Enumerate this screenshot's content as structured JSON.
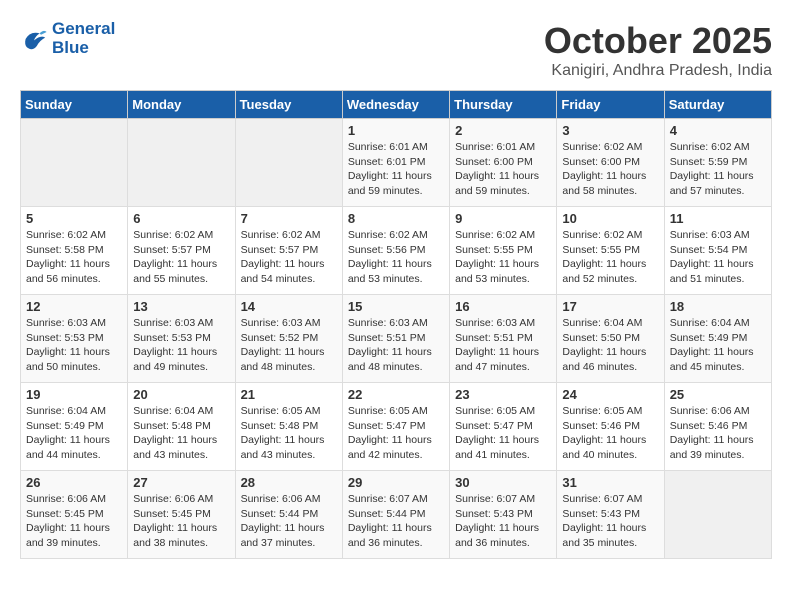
{
  "logo": {
    "line1": "General",
    "line2": "Blue"
  },
  "title": "October 2025",
  "subtitle": "Kanigiri, Andhra Pradesh, India",
  "weekdays": [
    "Sunday",
    "Monday",
    "Tuesday",
    "Wednesday",
    "Thursday",
    "Friday",
    "Saturday"
  ],
  "weeks": [
    [
      {
        "day": "",
        "info": ""
      },
      {
        "day": "",
        "info": ""
      },
      {
        "day": "",
        "info": ""
      },
      {
        "day": "1",
        "info": "Sunrise: 6:01 AM\nSunset: 6:01 PM\nDaylight: 11 hours\nand 59 minutes."
      },
      {
        "day": "2",
        "info": "Sunrise: 6:01 AM\nSunset: 6:00 PM\nDaylight: 11 hours\nand 59 minutes."
      },
      {
        "day": "3",
        "info": "Sunrise: 6:02 AM\nSunset: 6:00 PM\nDaylight: 11 hours\nand 58 minutes."
      },
      {
        "day": "4",
        "info": "Sunrise: 6:02 AM\nSunset: 5:59 PM\nDaylight: 11 hours\nand 57 minutes."
      }
    ],
    [
      {
        "day": "5",
        "info": "Sunrise: 6:02 AM\nSunset: 5:58 PM\nDaylight: 11 hours\nand 56 minutes."
      },
      {
        "day": "6",
        "info": "Sunrise: 6:02 AM\nSunset: 5:57 PM\nDaylight: 11 hours\nand 55 minutes."
      },
      {
        "day": "7",
        "info": "Sunrise: 6:02 AM\nSunset: 5:57 PM\nDaylight: 11 hours\nand 54 minutes."
      },
      {
        "day": "8",
        "info": "Sunrise: 6:02 AM\nSunset: 5:56 PM\nDaylight: 11 hours\nand 53 minutes."
      },
      {
        "day": "9",
        "info": "Sunrise: 6:02 AM\nSunset: 5:55 PM\nDaylight: 11 hours\nand 53 minutes."
      },
      {
        "day": "10",
        "info": "Sunrise: 6:02 AM\nSunset: 5:55 PM\nDaylight: 11 hours\nand 52 minutes."
      },
      {
        "day": "11",
        "info": "Sunrise: 6:03 AM\nSunset: 5:54 PM\nDaylight: 11 hours\nand 51 minutes."
      }
    ],
    [
      {
        "day": "12",
        "info": "Sunrise: 6:03 AM\nSunset: 5:53 PM\nDaylight: 11 hours\nand 50 minutes."
      },
      {
        "day": "13",
        "info": "Sunrise: 6:03 AM\nSunset: 5:53 PM\nDaylight: 11 hours\nand 49 minutes."
      },
      {
        "day": "14",
        "info": "Sunrise: 6:03 AM\nSunset: 5:52 PM\nDaylight: 11 hours\nand 48 minutes."
      },
      {
        "day": "15",
        "info": "Sunrise: 6:03 AM\nSunset: 5:51 PM\nDaylight: 11 hours\nand 48 minutes."
      },
      {
        "day": "16",
        "info": "Sunrise: 6:03 AM\nSunset: 5:51 PM\nDaylight: 11 hours\nand 47 minutes."
      },
      {
        "day": "17",
        "info": "Sunrise: 6:04 AM\nSunset: 5:50 PM\nDaylight: 11 hours\nand 46 minutes."
      },
      {
        "day": "18",
        "info": "Sunrise: 6:04 AM\nSunset: 5:49 PM\nDaylight: 11 hours\nand 45 minutes."
      }
    ],
    [
      {
        "day": "19",
        "info": "Sunrise: 6:04 AM\nSunset: 5:49 PM\nDaylight: 11 hours\nand 44 minutes."
      },
      {
        "day": "20",
        "info": "Sunrise: 6:04 AM\nSunset: 5:48 PM\nDaylight: 11 hours\nand 43 minutes."
      },
      {
        "day": "21",
        "info": "Sunrise: 6:05 AM\nSunset: 5:48 PM\nDaylight: 11 hours\nand 43 minutes."
      },
      {
        "day": "22",
        "info": "Sunrise: 6:05 AM\nSunset: 5:47 PM\nDaylight: 11 hours\nand 42 minutes."
      },
      {
        "day": "23",
        "info": "Sunrise: 6:05 AM\nSunset: 5:47 PM\nDaylight: 11 hours\nand 41 minutes."
      },
      {
        "day": "24",
        "info": "Sunrise: 6:05 AM\nSunset: 5:46 PM\nDaylight: 11 hours\nand 40 minutes."
      },
      {
        "day": "25",
        "info": "Sunrise: 6:06 AM\nSunset: 5:46 PM\nDaylight: 11 hours\nand 39 minutes."
      }
    ],
    [
      {
        "day": "26",
        "info": "Sunrise: 6:06 AM\nSunset: 5:45 PM\nDaylight: 11 hours\nand 39 minutes."
      },
      {
        "day": "27",
        "info": "Sunrise: 6:06 AM\nSunset: 5:45 PM\nDaylight: 11 hours\nand 38 minutes."
      },
      {
        "day": "28",
        "info": "Sunrise: 6:06 AM\nSunset: 5:44 PM\nDaylight: 11 hours\nand 37 minutes."
      },
      {
        "day": "29",
        "info": "Sunrise: 6:07 AM\nSunset: 5:44 PM\nDaylight: 11 hours\nand 36 minutes."
      },
      {
        "day": "30",
        "info": "Sunrise: 6:07 AM\nSunset: 5:43 PM\nDaylight: 11 hours\nand 36 minutes."
      },
      {
        "day": "31",
        "info": "Sunrise: 6:07 AM\nSunset: 5:43 PM\nDaylight: 11 hours\nand 35 minutes."
      },
      {
        "day": "",
        "info": ""
      }
    ]
  ]
}
